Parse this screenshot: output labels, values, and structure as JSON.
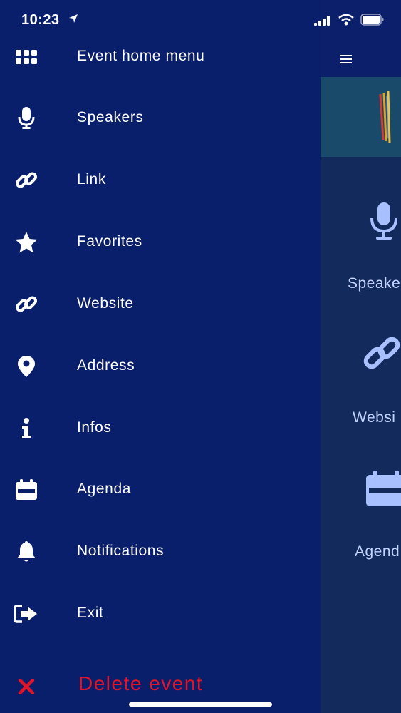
{
  "status_bar": {
    "time": "10:23"
  },
  "drawer": {
    "items": [
      {
        "label": "Event home menu",
        "icon": "grid-icon"
      },
      {
        "label": "Speakers",
        "icon": "microphone-icon"
      },
      {
        "label": "Link",
        "icon": "link-icon"
      },
      {
        "label": "Favorites",
        "icon": "star-icon"
      },
      {
        "label": "Website",
        "icon": "link-icon"
      },
      {
        "label": "Address",
        "icon": "map-pin-icon"
      },
      {
        "label": "Infos",
        "icon": "info-icon"
      },
      {
        "label": "Agenda",
        "icon": "calendar-icon"
      },
      {
        "label": "Notifications",
        "icon": "bell-icon"
      },
      {
        "label": "Exit",
        "icon": "exit-icon"
      }
    ],
    "delete": {
      "label": "Delete event",
      "icon": "close-icon"
    }
  },
  "background_app": {
    "tiles": [
      {
        "label": "Speake",
        "icon": "microphone-icon"
      },
      {
        "label": "Websi",
        "icon": "link-icon"
      },
      {
        "label": "Agend",
        "icon": "calendar-icon"
      }
    ]
  },
  "colors": {
    "drawer_bg": "#0a1f6b",
    "content_bg": "#122a5c",
    "accent_light": "#c4d4ff",
    "delete_red": "#e0152a"
  }
}
